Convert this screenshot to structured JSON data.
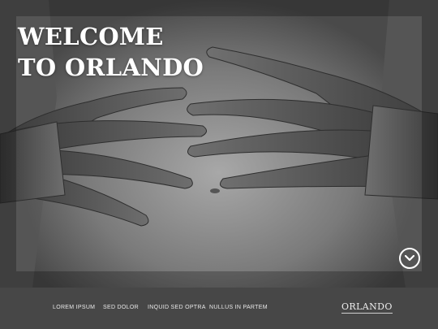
{
  "hero": {
    "title_line1": "WELCOME",
    "title_line2": "TO ORLANDO",
    "scroll_icon": "chevron-down-icon",
    "photo_subject": "hands-on-torso"
  },
  "nav": {
    "items": [
      {
        "label": "LOREM IPSUM"
      },
      {
        "label": "SED DOLOR"
      },
      {
        "label": "INQUID SED OPTRA"
      },
      {
        "label": "NULLUS IN PARTEM"
      }
    ],
    "logo": "ORLANDO"
  },
  "colors": {
    "navbar_bg": "#474747",
    "text": "#ffffff"
  }
}
